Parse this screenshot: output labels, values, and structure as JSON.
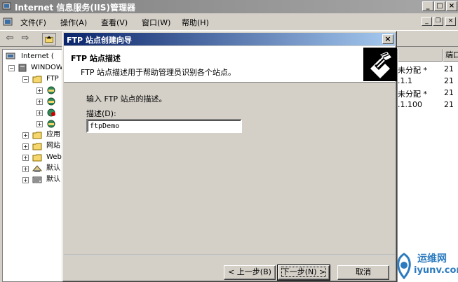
{
  "main_window": {
    "title": "Internet 信息服务(IIS)管理器",
    "title_buttons": {
      "minimize": "_",
      "maximize": "□",
      "close": "×"
    },
    "menu": [
      "文件(F)",
      "操作(A)",
      "查看(V)",
      "窗口(W)",
      "帮助(H)"
    ],
    "mdi_buttons": {
      "minimize": "_",
      "restore": "❐",
      "close": "×"
    }
  },
  "tree": {
    "items": [
      {
        "label": "Internet (",
        "icon": "computer-icon"
      },
      {
        "label": "WINDOWS",
        "icon": "server-icon"
      },
      {
        "label": "FTP",
        "icon": "folder-icon"
      },
      {
        "label": "",
        "icon": "ftp-site-icon"
      },
      {
        "label": "",
        "icon": "ftp-site-icon"
      },
      {
        "label": "",
        "icon": "ftp-site-stopped-icon"
      },
      {
        "label": "",
        "icon": "ftp-site-icon"
      },
      {
        "label": "应用",
        "icon": "folder-icon"
      },
      {
        "label": "网站",
        "icon": "folder-icon"
      },
      {
        "label": "Web",
        "icon": "folder-icon"
      },
      {
        "label": "默认",
        "icon": "smtp-icon"
      },
      {
        "label": "默认",
        "icon": "nntp-icon"
      }
    ]
  },
  "list": {
    "column": "端口",
    "rows": [
      {
        "ip": "未分配 *",
        "port": "21"
      },
      {
        "ip": ".1.1",
        "port": "21"
      },
      {
        "ip": "未分配 *",
        "port": "21"
      },
      {
        "ip": ".1.100",
        "port": "21"
      }
    ]
  },
  "wizard": {
    "title": "FTP 站点创建向导",
    "close": "×",
    "header_title": "FTP 站点描述",
    "header_subtitle": "FTP 站点描述用于帮助管理员识别各个站点。",
    "intro": "输入 FTP 站点的描述。",
    "field_label": "描述(D):",
    "field_value": "ftpDemo",
    "buttons": {
      "back": "< 上一步(B)",
      "next": "下一步(N) >",
      "cancel": "取消"
    }
  },
  "watermark": {
    "cn": "运维网",
    "en": "iyunv.com"
  }
}
